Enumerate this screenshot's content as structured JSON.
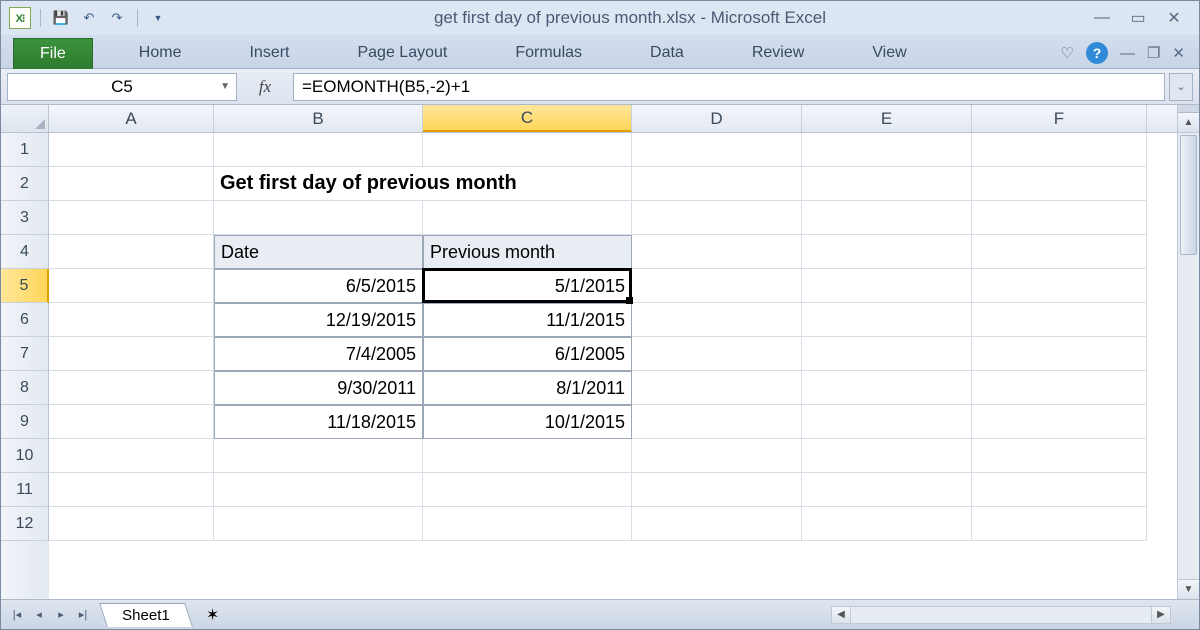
{
  "window": {
    "title": "get first day of previous month.xlsx  -  Microsoft Excel"
  },
  "qat": {
    "save": "💾",
    "undo": "↶",
    "redo": "↷"
  },
  "ribbon": {
    "file": "File",
    "tabs": [
      "Home",
      "Insert",
      "Page Layout",
      "Formulas",
      "Data",
      "Review",
      "View"
    ]
  },
  "formula_bar": {
    "name_box": "C5",
    "fx_label": "fx",
    "formula": "=EOMONTH(B5,-2)+1"
  },
  "columns": [
    "A",
    "B",
    "C",
    "D",
    "E",
    "F"
  ],
  "rows": [
    "1",
    "2",
    "3",
    "4",
    "5",
    "6",
    "7",
    "8",
    "9",
    "10",
    "11",
    "12"
  ],
  "selected": {
    "col": "C",
    "row": "5"
  },
  "content": {
    "title": "Get first day of previous month",
    "headers": {
      "date": "Date",
      "prev": "Previous month"
    },
    "data": [
      {
        "date": "6/5/2015",
        "prev": "5/1/2015"
      },
      {
        "date": "12/19/2015",
        "prev": "11/1/2015"
      },
      {
        "date": "7/4/2005",
        "prev": "6/1/2005"
      },
      {
        "date": "9/30/2011",
        "prev": "8/1/2011"
      },
      {
        "date": "11/18/2015",
        "prev": "10/1/2015"
      }
    ]
  },
  "sheet_tabs": {
    "active": "Sheet1"
  },
  "icons": {
    "excel": "X⁝",
    "help": "?",
    "heart": "♡",
    "minimize": "—",
    "maximize": "▭",
    "close": "✕",
    "restore": "❐",
    "first": "|◂",
    "prev": "◂",
    "next": "▸",
    "last": "▸|",
    "up": "▲",
    "down": "▼",
    "left": "◀",
    "right": "▶",
    "expand": "⌄",
    "dropdown": "▼",
    "newsheet": "✶"
  }
}
